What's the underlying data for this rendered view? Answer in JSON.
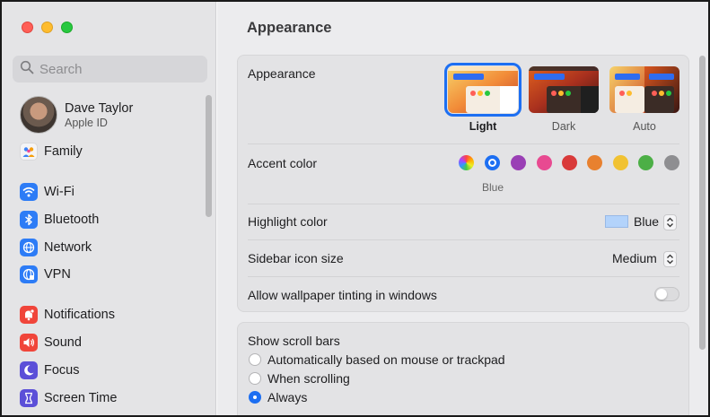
{
  "sidebar": {
    "search_placeholder": "Search",
    "profile": {
      "name": "Dave Taylor",
      "subtitle": "Apple ID"
    },
    "items": [
      {
        "label": "Family",
        "icon": "family-icon",
        "color": "#e9e9eb"
      },
      {
        "label": "Wi-Fi",
        "icon": "wifi-icon",
        "color": "#2d7cf6"
      },
      {
        "label": "Bluetooth",
        "icon": "bluetooth-icon",
        "color": "#2d7cf6"
      },
      {
        "label": "Network",
        "icon": "network-icon",
        "color": "#2d7cf6"
      },
      {
        "label": "VPN",
        "icon": "vpn-icon",
        "color": "#2d7cf6"
      },
      {
        "label": "Notifications",
        "icon": "notifications-icon",
        "color": "#f0453a"
      },
      {
        "label": "Sound",
        "icon": "sound-icon",
        "color": "#f0453a"
      },
      {
        "label": "Focus",
        "icon": "focus-icon",
        "color": "#5b4fd8"
      },
      {
        "label": "Screen Time",
        "icon": "screen-time-icon",
        "color": "#5b4fd8"
      }
    ]
  },
  "main": {
    "title": "Appearance",
    "appearance": {
      "label": "Appearance",
      "options": [
        {
          "label": "Light",
          "selected": true
        },
        {
          "label": "Dark",
          "selected": false
        },
        {
          "label": "Auto",
          "selected": false
        }
      ]
    },
    "accent": {
      "label": "Accent color",
      "selected_name": "Blue",
      "colors": [
        "multicolor",
        "#1d6ff2",
        "#9a3fb5",
        "#e84a91",
        "#d93a3a",
        "#e8812f",
        "#f1c232",
        "#4caf46",
        "#8e8e91"
      ]
    },
    "highlight": {
      "label": "Highlight color",
      "value": "Blue",
      "swatch": "#b3d3fb"
    },
    "sidebar_icon_size": {
      "label": "Sidebar icon size",
      "value": "Medium"
    },
    "wallpaper_tinting": {
      "label": "Allow wallpaper tinting in windows",
      "enabled": false
    },
    "scroll_bars": {
      "label": "Show scroll bars",
      "options": [
        {
          "label": "Automatically based on mouse or trackpad",
          "selected": false
        },
        {
          "label": "When scrolling",
          "selected": false
        },
        {
          "label": "Always",
          "selected": true
        }
      ]
    }
  },
  "colors": {
    "accent": "#1d6ff2"
  }
}
